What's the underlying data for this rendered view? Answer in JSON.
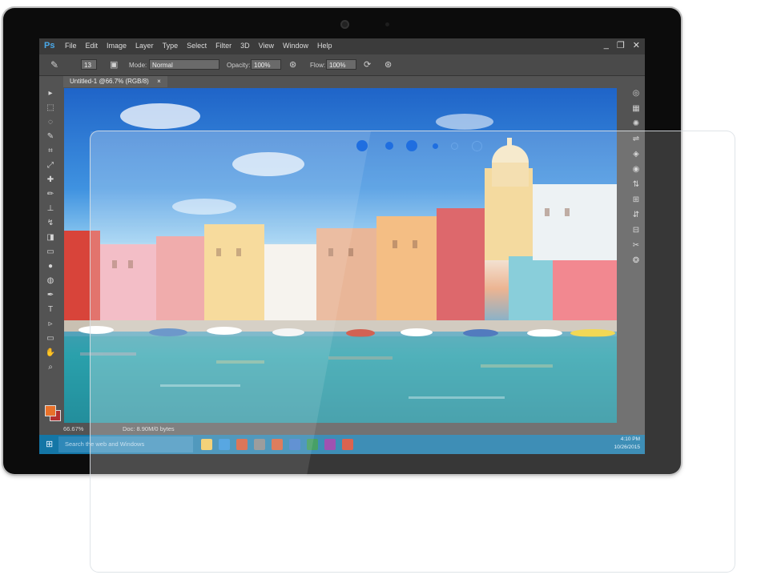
{
  "photoshop": {
    "logo": "Ps",
    "menus": [
      "File",
      "Edit",
      "Image",
      "Layer",
      "Type",
      "Select",
      "Filter",
      "3D",
      "View",
      "Window",
      "Help"
    ],
    "window_controls": [
      "_",
      "❐",
      "✕"
    ],
    "options": {
      "brush_size": "13",
      "mode_label": "Mode:",
      "mode_value": "Normal",
      "opacity_label": "Opacity:",
      "opacity_value": "100%",
      "flow_label": "Flow:",
      "flow_value": "100%"
    },
    "document_tab": "Untitled-1 @66.7% (RGB/8)",
    "document_tab_close": "×",
    "status": {
      "zoom": "66.67%",
      "doc": "Doc: 8.90M/0 bytes"
    },
    "tools": [
      "move-icon",
      "marquee-icon",
      "lasso-icon",
      "quick-select-icon",
      "crop-icon",
      "eyedropper-icon",
      "healing-icon",
      "brush-icon",
      "stamp-icon",
      "history-brush-icon",
      "eraser-icon",
      "gradient-icon",
      "blur-icon",
      "dodge-icon",
      "pen-icon",
      "type-icon",
      "path-select-icon",
      "shape-icon",
      "hand-icon",
      "zoom-icon"
    ],
    "tool_glyphs": [
      "▸",
      "⬚",
      "◌",
      "✎",
      "⌗",
      "⤢",
      "✚",
      "✏",
      "⊥",
      "↯",
      "◨",
      "▭",
      "●",
      "◍",
      "✒",
      "T",
      "▹",
      "▭",
      "✋",
      "⌕"
    ],
    "type_tool_label": "T",
    "swatch_colors": {
      "foreground": "#e8712a",
      "background": "#b43030"
    },
    "right_panel_glyphs": [
      "◎",
      "▦",
      "✺",
      "⇌",
      "◈",
      "◉",
      "⇅",
      "⊞",
      "⇵",
      "⊟",
      "✂",
      "❂"
    ],
    "right_panel_icons": [
      "history-icon",
      "swatches-icon",
      "adjustments-icon",
      "properties-icon",
      "layers-icon",
      "channels-icon",
      "paths-icon",
      "clone-source-icon",
      "brush-presets-icon",
      "character-icon",
      "paragraph-icon",
      "cc-icon"
    ]
  },
  "taskbar": {
    "search_placeholder": "Search the web and Windows",
    "time": "4:10 PM",
    "date": "10/26/2015",
    "app_colors": [
      "#f0c24a",
      "#1e88d8",
      "#d0461e",
      "#7a7a7a",
      "#d45024",
      "#2b6cc4",
      "#1f8b45",
      "#8a2ca0",
      "#d4412a"
    ]
  },
  "carousel": {
    "count": 6,
    "active": 2
  },
  "colors": {
    "accent_taskbar": "#1476a6",
    "ps_blue": "#4aa8e8"
  }
}
